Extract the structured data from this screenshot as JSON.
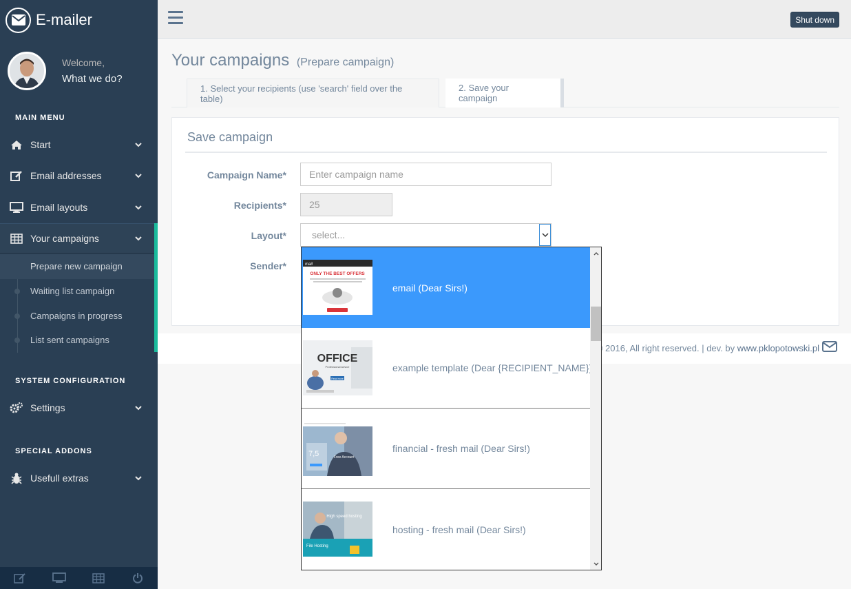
{
  "brand": {
    "title": "E-mailer"
  },
  "profile": {
    "welcome": "Welcome,",
    "name": "What we do?"
  },
  "sidebar": {
    "main_menu_title": "MAIN MENU",
    "items": [
      {
        "label": "Start",
        "icon": "home-icon"
      },
      {
        "label": "Email addresses",
        "icon": "edit-icon"
      },
      {
        "label": "Email layouts",
        "icon": "desktop-icon"
      },
      {
        "label": "Your campaigns",
        "icon": "table-icon"
      }
    ],
    "campaign_sub": [
      {
        "label": "Prepare new campaign"
      },
      {
        "label": "Waiting list campaign"
      },
      {
        "label": "Campaigns in progress"
      },
      {
        "label": "List sent campaigns"
      }
    ],
    "system_title": "SYSTEM CONFIGURATION",
    "settings_label": "Settings",
    "addons_title": "SPECIAL ADDONS",
    "extras_label": "Usefull extras"
  },
  "topnav": {
    "shutdown_label": "Shut down"
  },
  "page": {
    "title": "Your campaigns",
    "subtitle": "(Prepare campaign)"
  },
  "tabs": [
    {
      "label": "1. Select your recipients (use 'search' field over the table)"
    },
    {
      "label": "2. Save your campaign"
    }
  ],
  "panel": {
    "title": "Save campaign"
  },
  "form": {
    "name_label": "Campaign Name*",
    "name_placeholder": "Enter campaign name",
    "recipients_label": "Recipients*",
    "recipients_value": "25",
    "layout_label": "Layout*",
    "layout_selected": "select...",
    "sender_label": "Sender*"
  },
  "dropdown": {
    "options": [
      {
        "label": "email (Dear Sirs!)",
        "thumb_text": "ONLY THE BEST OFFERS",
        "thumb_logo": "mail"
      },
      {
        "label": "example template (Dear {RECIPIENT_NAME})",
        "thumb_text": "OFFICE",
        "thumb_sub": "Professional Advice",
        "thumb_btn": "Read more"
      },
      {
        "label": "financial - fresh mail (Dear Sirs!)",
        "thumb_text": "7,5",
        "thumb_sub": "Free Account"
      },
      {
        "label": "hosting - fresh mail (Dear Sirs!)",
        "thumb_text": "High speed hosting",
        "thumb_sub": "File Hosting"
      }
    ]
  },
  "footer": {
    "text": "© 2016, All right reserved. | dev. by",
    "link": "www.pklopotowski.pl"
  },
  "colors": {
    "sidebar": "#2a3f54",
    "accent": "#1abb9c",
    "selected": "#3b99fc"
  }
}
